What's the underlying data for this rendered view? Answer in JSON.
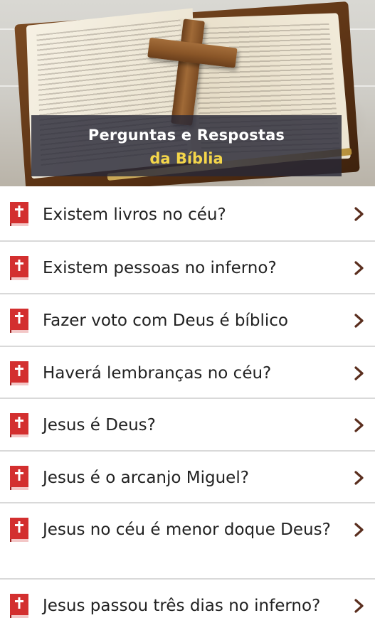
{
  "header": {
    "title_line1": "Perguntas e Respostas",
    "title_line2": "da Bíblia"
  },
  "colors": {
    "title_highlight": "#f4d64a",
    "icon_red": "#d32f2f",
    "chevron": "#5a2e1e",
    "divider": "#d9d9d9",
    "text": "#222222"
  },
  "icons": {
    "list_item_icon": "bible-cross-icon",
    "list_item_action": "chevron-right-icon"
  },
  "questions": [
    {
      "label": "Existem livros no céu?"
    },
    {
      "label": "Existem pessoas no inferno?"
    },
    {
      "label": "Fazer voto com Deus é bíblico"
    },
    {
      "label": "Haverá lembranças no céu?"
    },
    {
      "label": "Jesus é Deus?"
    },
    {
      "label": "Jesus é o arcanjo Miguel?"
    },
    {
      "label": "Jesus no céu é menor doque Deus?"
    },
    {
      "label": "Jesus passou três dias no inferno?"
    }
  ]
}
